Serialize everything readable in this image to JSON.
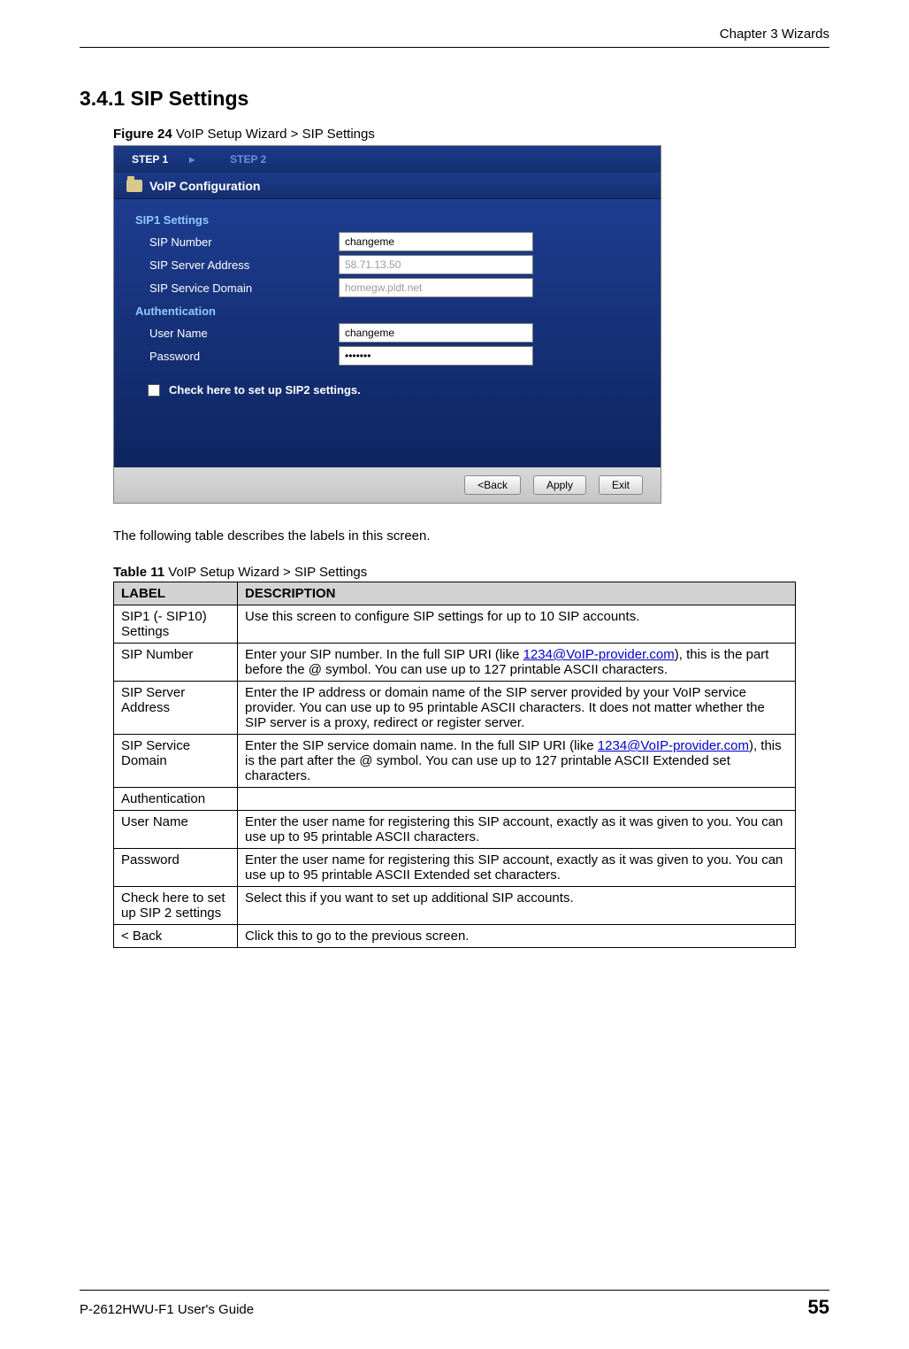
{
  "chapter_header": "Chapter 3 Wizards",
  "section_heading": "3.4.1  SIP Settings",
  "figure": {
    "label": "Figure 24",
    "caption": "   VoIP Setup Wizard > SIP Settings"
  },
  "screenshot": {
    "steps": {
      "step1": "STEP 1",
      "step2": "STEP 2"
    },
    "title": "VoIP Configuration",
    "sip1_label": "SIP1  Settings",
    "fields": {
      "sip_number_label": "SIP Number",
      "sip_number_value": "changeme",
      "sip_server_label": "SIP Server Address",
      "sip_server_value": "58.71.13.50",
      "sip_domain_label": "SIP Service Domain",
      "sip_domain_value": "homegw.pldt.net"
    },
    "auth_label": "Authentication",
    "auth_fields": {
      "user_label": "User Name",
      "user_value": "changeme",
      "pass_label": "Password",
      "pass_value": "•••••••"
    },
    "sip2_check_label": "Check here to set up SIP2 settings.",
    "buttons": {
      "back": "<Back",
      "apply": "Apply",
      "exit": "Exit"
    }
  },
  "after_figure_text": "The following table describes the labels in this screen.",
  "table_caption": {
    "label": "Table 11",
    "caption": "   VoIP Setup Wizard > SIP Settings"
  },
  "table": {
    "headers": {
      "label": "LABEL",
      "desc": "DESCRIPTION"
    },
    "rows": [
      {
        "label": "SIP1 (- SIP10) Settings",
        "desc_parts": [
          {
            "t": "Use this screen to configure SIP settings for up to 10 SIP accounts."
          }
        ]
      },
      {
        "label": "SIP Number",
        "desc_parts": [
          {
            "t": "Enter your SIP number. In the full SIP URI (like "
          },
          {
            "t": "1234@VoIP-provider.com",
            "link": true
          },
          {
            "t": "), this is the part before the @ symbol. You can use up to 127 printable ASCII characters."
          }
        ]
      },
      {
        "label": "SIP Server Address",
        "desc_parts": [
          {
            "t": "Enter the IP address or domain name of the SIP server provided by your VoIP service provider. You can use up to 95 printable ASCII characters. It does not matter whether the SIP server is a proxy, redirect or register server."
          }
        ]
      },
      {
        "label": "SIP Service Domain",
        "desc_parts": [
          {
            "t": "Enter the SIP service domain name. In the full SIP URI (like "
          },
          {
            "t": "1234@VoIP-provider.com",
            "link": true
          },
          {
            "t": "), this is the part after the @ symbol. You can use up to 127 printable ASCII Extended set characters."
          }
        ]
      },
      {
        "label": "Authentication",
        "desc_parts": [
          {
            "t": ""
          }
        ]
      },
      {
        "label": "User Name",
        "desc_parts": [
          {
            "t": "Enter the user name for registering this SIP account, exactly as it was given to you. You can use up to 95 printable ASCII characters."
          }
        ]
      },
      {
        "label": "Password",
        "desc_parts": [
          {
            "t": "Enter the user name for registering this SIP account, exactly as it was given to you. You can use up to 95 printable ASCII Extended set characters."
          }
        ]
      },
      {
        "label": "Check here to set up SIP 2 settings",
        "desc_parts": [
          {
            "t": "Select this if you want to set up additional SIP accounts."
          }
        ]
      },
      {
        "label": "< Back",
        "desc_parts": [
          {
            "t": "Click this to go to the previous screen."
          }
        ]
      }
    ]
  },
  "footer": {
    "guide": "P-2612HWU-F1 User's Guide",
    "page": "55"
  }
}
